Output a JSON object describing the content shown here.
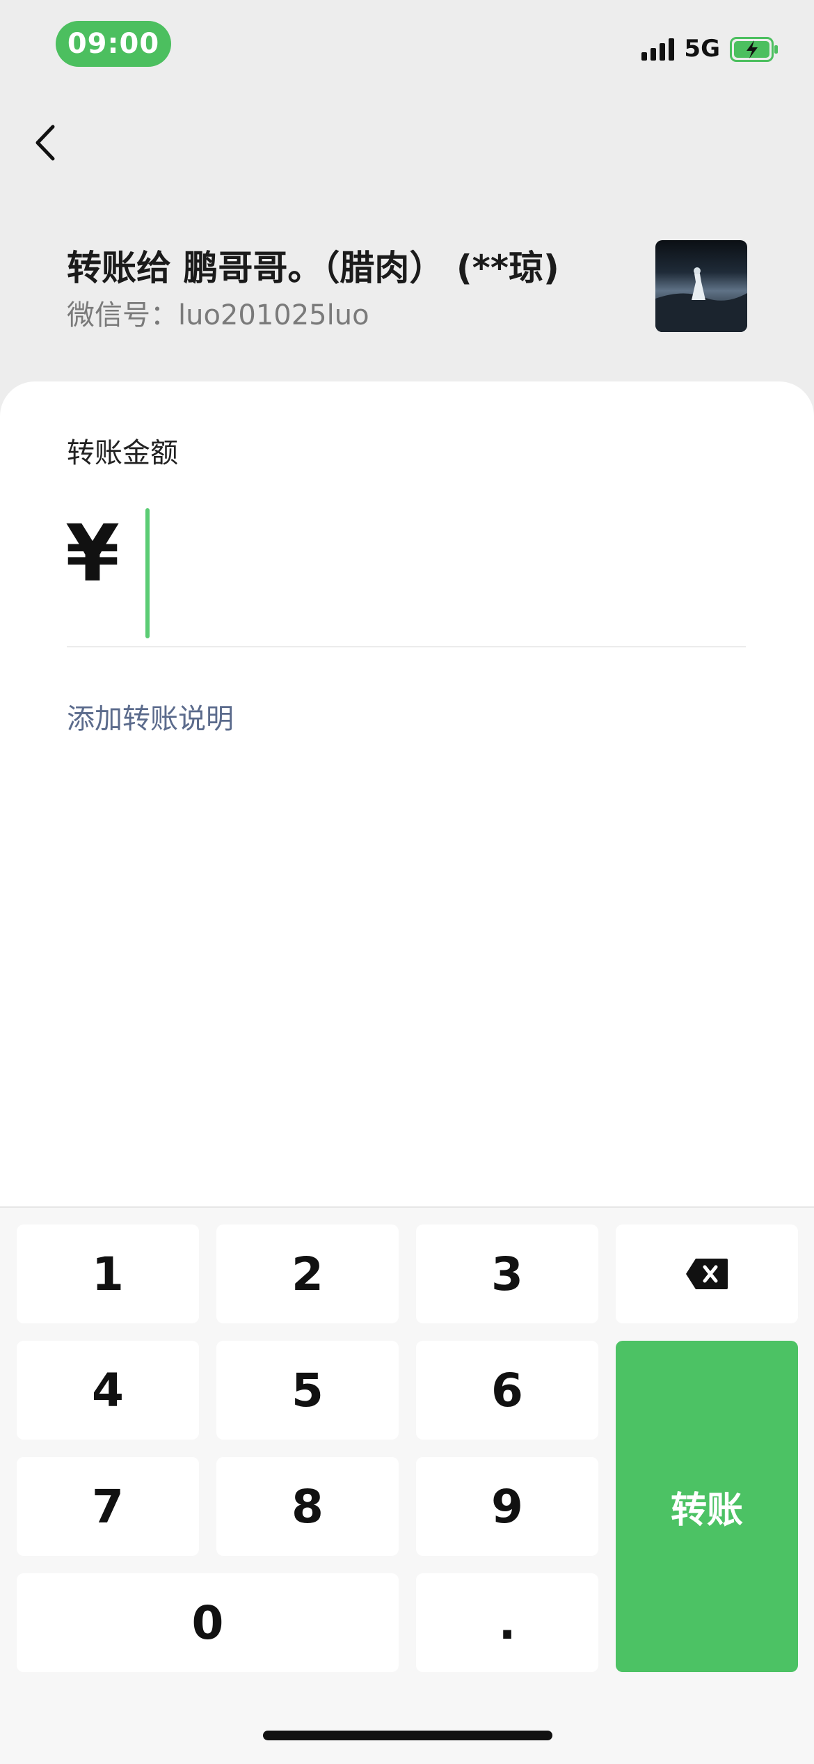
{
  "status_bar": {
    "time": "09:00",
    "network": "5G",
    "battery_icon": "battery-charging-icon"
  },
  "nav": {
    "back_icon": "chevron-left-icon"
  },
  "payee": {
    "title": "转账给 鹏哥哥。（腊肉） (**琼)",
    "wechat_id": "微信号：luo201025luo",
    "avatar": "avatar-image"
  },
  "amount": {
    "label": "转账金额",
    "currency_symbol": "¥",
    "value": ""
  },
  "note": {
    "add_label": "添加转账说明"
  },
  "keypad": {
    "keys": [
      "1",
      "2",
      "3",
      "4",
      "5",
      "6",
      "7",
      "8",
      "9",
      "0",
      "."
    ],
    "backspace_icon": "backspace-icon",
    "submit_label": "转账"
  },
  "colors": {
    "accent": "#4cc264",
    "status_pill": "#4cbf5f",
    "link": "#5b6b8c"
  }
}
